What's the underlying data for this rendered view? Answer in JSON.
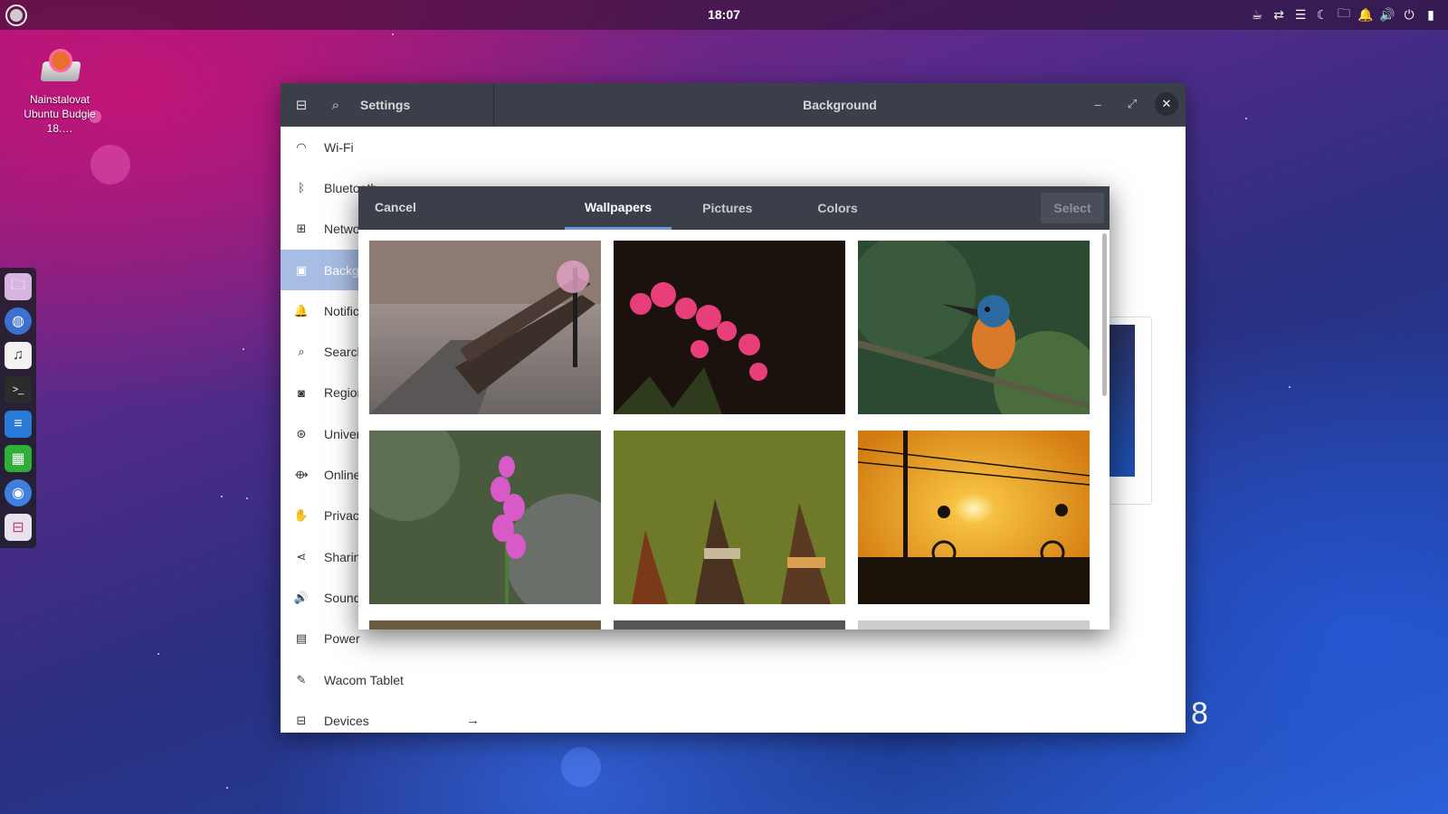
{
  "top_panel": {
    "clock": "18:07",
    "tray_icons": [
      "caffeine-icon",
      "network-transfer-icon",
      "menu-lines-icon",
      "night-light-icon",
      "folder-icon",
      "notifications-bell-icon",
      "volume-icon",
      "power-icon",
      "battery-icon"
    ]
  },
  "desktop": {
    "icon_label": "Nainstalovat Ubuntu Budgie 18.…",
    "corner_text": "8"
  },
  "dock": {
    "apps": [
      "files-app",
      "web-browser-app",
      "music-app",
      "terminal-app",
      "writer-app",
      "calc-app",
      "chrome-app",
      "settings-app"
    ]
  },
  "settings": {
    "title_left": "Settings",
    "title": "Background",
    "sidebar": [
      {
        "label": "Wi-Fi",
        "icon": "wifi-icon"
      },
      {
        "label": "Bluetooth",
        "icon": "bluetooth-icon"
      },
      {
        "label": "Network",
        "icon": "network-icon"
      },
      {
        "label": "Background",
        "icon": "background-icon",
        "active": true
      },
      {
        "label": "Notifications",
        "icon": "bell-icon"
      },
      {
        "label": "Search",
        "icon": "search-icon"
      },
      {
        "label": "Region & Language",
        "icon": "camera-icon"
      },
      {
        "label": "Universal Access",
        "icon": "accessibility-icon"
      },
      {
        "label": "Online Accounts",
        "icon": "online-accounts-icon"
      },
      {
        "label": "Privacy",
        "icon": "hand-icon"
      },
      {
        "label": "Sharing",
        "icon": "share-icon"
      },
      {
        "label": "Sound",
        "icon": "speaker-icon"
      },
      {
        "label": "Power",
        "icon": "power-icon"
      },
      {
        "label": "Wacom Tablet",
        "icon": "tablet-icon"
      },
      {
        "label": "Devices",
        "icon": "devices-icon"
      }
    ]
  },
  "dialog": {
    "cancel": "Cancel",
    "tabs": [
      "Wallpapers",
      "Pictures",
      "Colors"
    ],
    "active_tab": "Wallpapers",
    "select": "Select"
  }
}
